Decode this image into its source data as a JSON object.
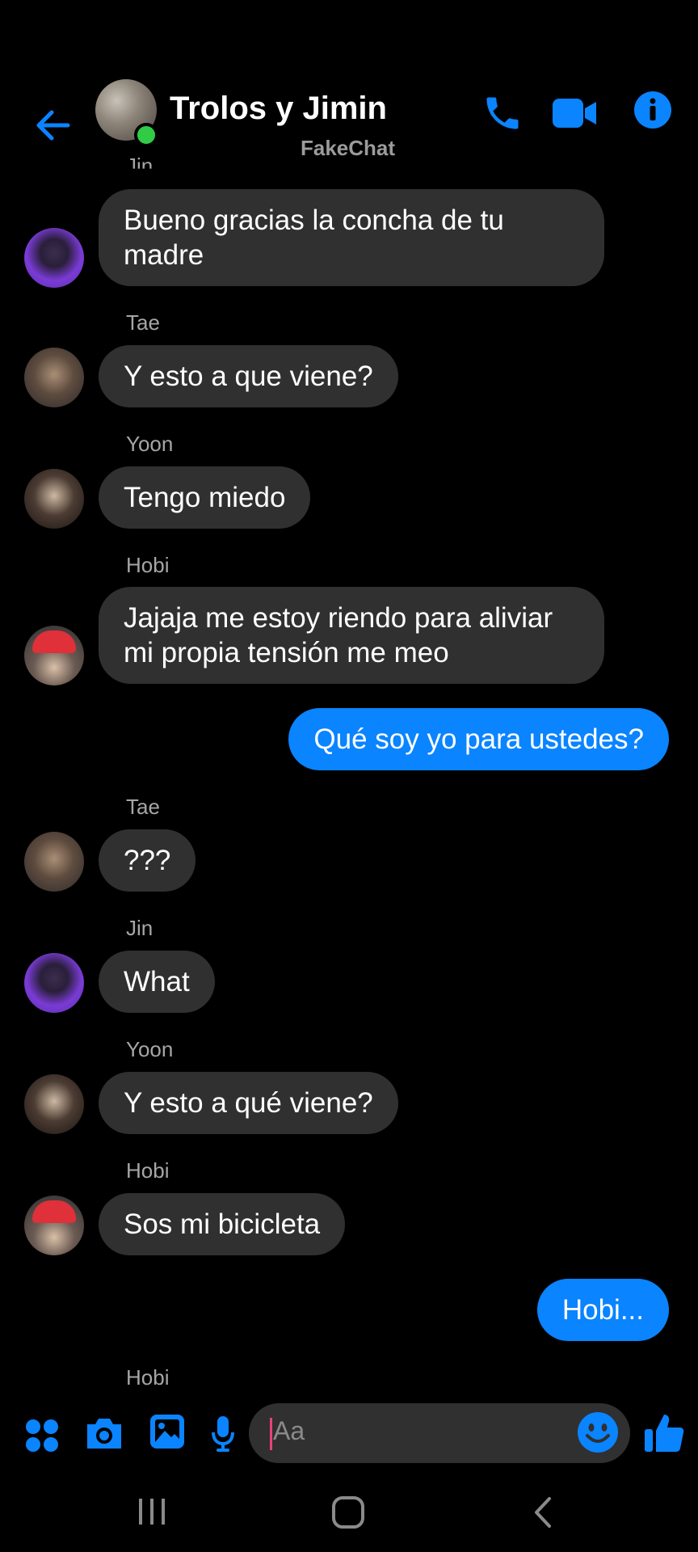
{
  "header": {
    "title": "Trolos y Jimin",
    "subtitle": "FakeChat"
  },
  "messages": [
    {
      "sender": "Jin",
      "text_lines": [
        "Bueno gracias la concha de tu",
        "madre"
      ],
      "avatar": "jin"
    },
    {
      "sender": "Tae",
      "text": "Y esto a que viene?",
      "avatar": "tae"
    },
    {
      "sender": "Yoon",
      "text": "Tengo miedo",
      "avatar": "yoon"
    },
    {
      "sender": "Hobi",
      "text_lines": [
        "Jajaja me estoy riendo para aliviar",
        "mi propia tensión me meo"
      ],
      "avatar": "hobi"
    },
    {
      "sender": "me",
      "text": "Qué soy yo para ustedes?"
    },
    {
      "sender": "Tae",
      "text": "???",
      "avatar": "tae"
    },
    {
      "sender": "Jin",
      "text": "What",
      "avatar": "jin"
    },
    {
      "sender": "Yoon",
      "text": "Y esto a qué viene?",
      "avatar": "yoon"
    },
    {
      "sender": "Hobi",
      "text": "Sos mi bicicleta",
      "avatar": "hobi"
    },
    {
      "sender": "me",
      "text": "Hobi..."
    },
    {
      "sender": "Hobi",
      "text": "",
      "avatar": "hobi"
    }
  ],
  "composer": {
    "placeholder": "Aa"
  },
  "colors": {
    "accent": "#0a84ff",
    "incoming_bubble": "#303030",
    "background": "#000000",
    "online": "#31cc46"
  },
  "icons": [
    "back-arrow-icon",
    "phone-icon",
    "video-camera-icon",
    "info-icon",
    "apps-icon",
    "camera-icon",
    "gallery-icon",
    "microphone-icon",
    "emoji-icon",
    "thumbs-up-icon",
    "recent-apps-icon",
    "home-icon",
    "back-nav-icon"
  ]
}
